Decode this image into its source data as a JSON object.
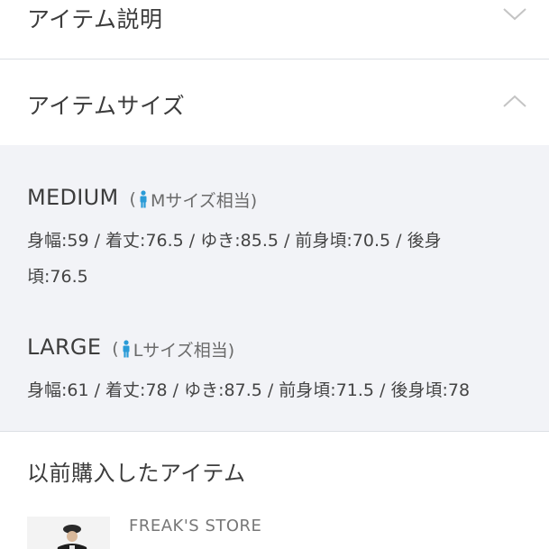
{
  "accordion": {
    "description_title": "アイテム説明",
    "size_title": "アイテムサイズ"
  },
  "sizes": [
    {
      "name": "MEDIUM",
      "equiv_prefix": "(",
      "equiv_text": "Mサイズ相当)",
      "measurements": "身幅:59 / 着丈:76.5 / ゆき:85.5 / 前身頃:70.5 / 後身頃:76.5"
    },
    {
      "name": "LARGE",
      "equiv_prefix": "(",
      "equiv_text": "Lサイズ相当)",
      "measurements": "身幅:61 / 着丈:78 / ゆき:87.5 / 前身頃:71.5 / 後身頃:78"
    }
  ],
  "history": {
    "title": "以前購入したアイテム",
    "items": [
      {
        "brand": "FREAK'S STORE",
        "thumbnail_icon": "product-thumbnail"
      }
    ]
  },
  "colors": {
    "accent_icon": "#2a9bd7",
    "panel_bg": "#f2f3f7",
    "divider": "#dcdfe4"
  }
}
